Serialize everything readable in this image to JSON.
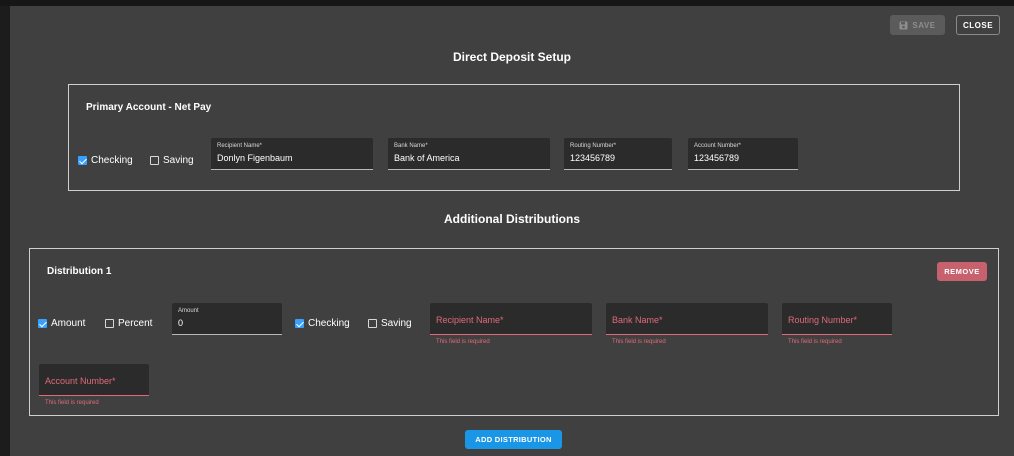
{
  "toolbar": {
    "save_label": "SAVE",
    "close_label": "CLOSE"
  },
  "dialog": {
    "title": "Direct Deposit Setup"
  },
  "primary": {
    "title": "Primary Account - Net Pay",
    "checking_label": "Checking",
    "saving_label": "Saving",
    "checking_checked": true,
    "saving_checked": false,
    "recipient": {
      "label": "Recipient Name*",
      "value": "Donlyn Figenbaum"
    },
    "bank": {
      "label": "Bank Name*",
      "value": "Bank of America"
    },
    "routing": {
      "label": "Routing Number*",
      "value": "123456789"
    },
    "account": {
      "label": "Account Number*",
      "value": "123456789"
    }
  },
  "additional": {
    "title": "Additional Distributions",
    "distributions": [
      {
        "title": "Distribution 1",
        "remove_label": "REMOVE",
        "amount_label": "Amount",
        "percent_label": "Percent",
        "amount_checked": true,
        "percent_checked": false,
        "amount_field": {
          "label": "Amount",
          "value": "0"
        },
        "checking_label": "Checking",
        "saving_label": "Saving",
        "checking_checked": true,
        "saving_checked": false,
        "recipient": {
          "placeholder": "Recipient Name*",
          "error": "This field is required"
        },
        "bank": {
          "placeholder": "Bank Name*",
          "error": "This field is required"
        },
        "routing": {
          "placeholder": "Routing Number*",
          "error": "This field is required"
        },
        "account": {
          "placeholder": "Account Number*",
          "error": "This field is required"
        }
      }
    ],
    "add_label": "ADD DISTRIBUTION"
  },
  "colors": {
    "accent": "#38a0ff",
    "error": "#e06a7a",
    "remove": "#c7616d",
    "add": "#1a96e6"
  }
}
